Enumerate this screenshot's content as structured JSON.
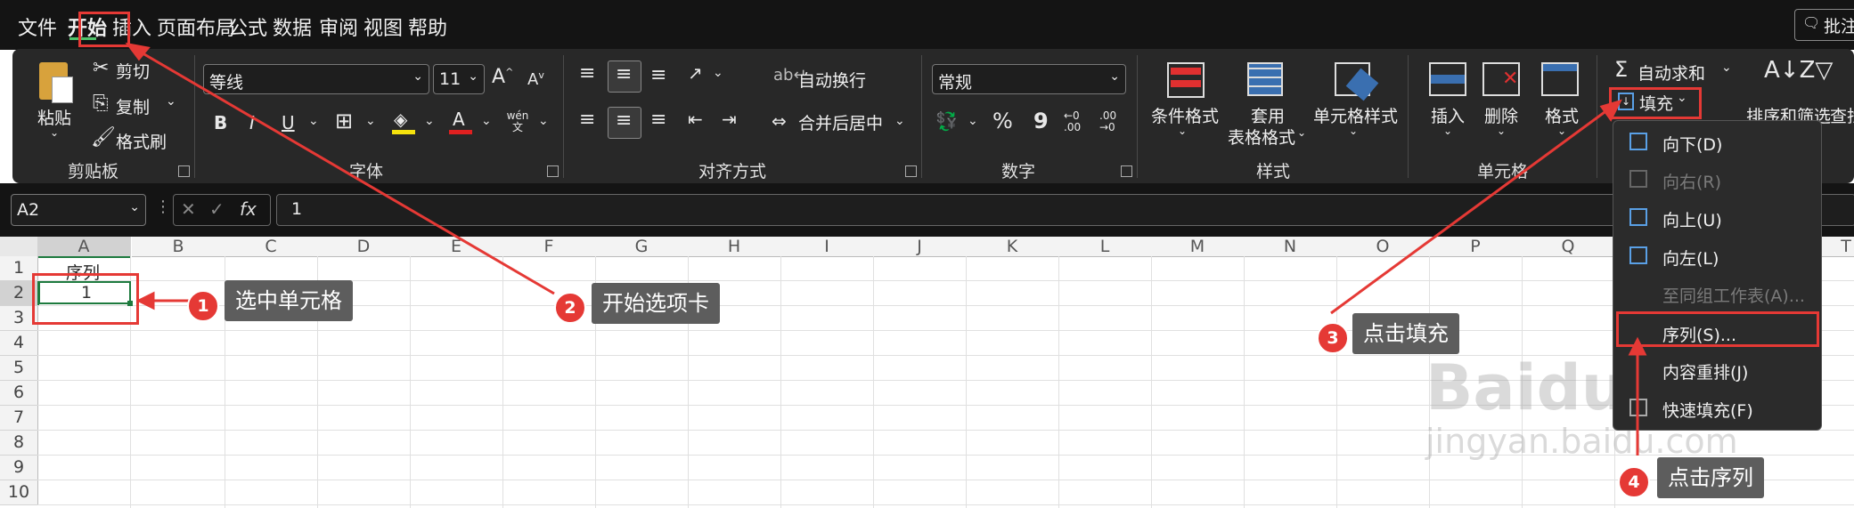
{
  "menu": [
    "文件",
    "开始",
    "插入",
    "页面布局",
    "公式",
    "数据",
    "审阅",
    "视图",
    "帮助"
  ],
  "comments_button": "批注",
  "clipboard": {
    "paste": "粘贴",
    "cut": "剪切",
    "copy": "复制",
    "format_painter": "格式刷",
    "group": "剪贴板"
  },
  "font": {
    "name": "等线",
    "size": "11",
    "group": "字体",
    "bold": "B",
    "italic": "I",
    "underline": "U",
    "phonetic": "wén 文"
  },
  "alignment": {
    "wrap": "自动换行",
    "merge": "合并后居中",
    "group": "对齐方式"
  },
  "number": {
    "format": "常规",
    "percent": "%",
    "comma": "9",
    "group": "数字"
  },
  "styles": {
    "conditional": "条件格式",
    "table_format_1": "套用",
    "table_format_2": "表格格式",
    "cell_styles": "单元格样式",
    "group": "样式"
  },
  "cells": {
    "insert": "插入",
    "delete": "删除",
    "format": "格式",
    "group": "单元格"
  },
  "editing": {
    "autosum": "自动求和",
    "fill": "填充",
    "sort_filter": "排序和筛选",
    "find": "查找"
  },
  "fill_menu": [
    {
      "label": "向下(D)",
      "enabled": true
    },
    {
      "label": "向右(R)",
      "enabled": false
    },
    {
      "label": "向上(U)",
      "enabled": true
    },
    {
      "label": "向左(L)",
      "enabled": true
    },
    {
      "label": "至同组工作表(A)...",
      "enabled": false
    },
    {
      "label": "序列(S)...",
      "enabled": true
    },
    {
      "label": "内容重排(J)",
      "enabled": true
    },
    {
      "label": "快速填充(F)",
      "enabled": true
    }
  ],
  "formula_bar": {
    "name_box": "A2",
    "fx": "fx",
    "value": "1"
  },
  "columns": [
    "A",
    "B",
    "C",
    "D",
    "E",
    "F",
    "G",
    "H",
    "I",
    "J",
    "K",
    "L",
    "M",
    "N",
    "O",
    "P",
    "Q",
    "T"
  ],
  "rows": [
    "1",
    "2",
    "3",
    "4",
    "5",
    "6",
    "7",
    "8",
    "9",
    "10"
  ],
  "cells_data": {
    "A1": "序列",
    "A2": "1"
  },
  "callouts": [
    {
      "num": "1",
      "text": "选中单元格"
    },
    {
      "num": "2",
      "text": "开始选项卡"
    },
    {
      "num": "3",
      "text": "点击填充"
    },
    {
      "num": "4",
      "text": "点击序列"
    }
  ],
  "watermark": {
    "brand": "Baidu 经验",
    "url": "jingyan.baidu.com"
  },
  "colors": {
    "accent_red": "#e53935",
    "ribbon_bg": "#282828",
    "menubar_bg": "#141414",
    "fill_icon_blue": "#5aa0e6"
  }
}
